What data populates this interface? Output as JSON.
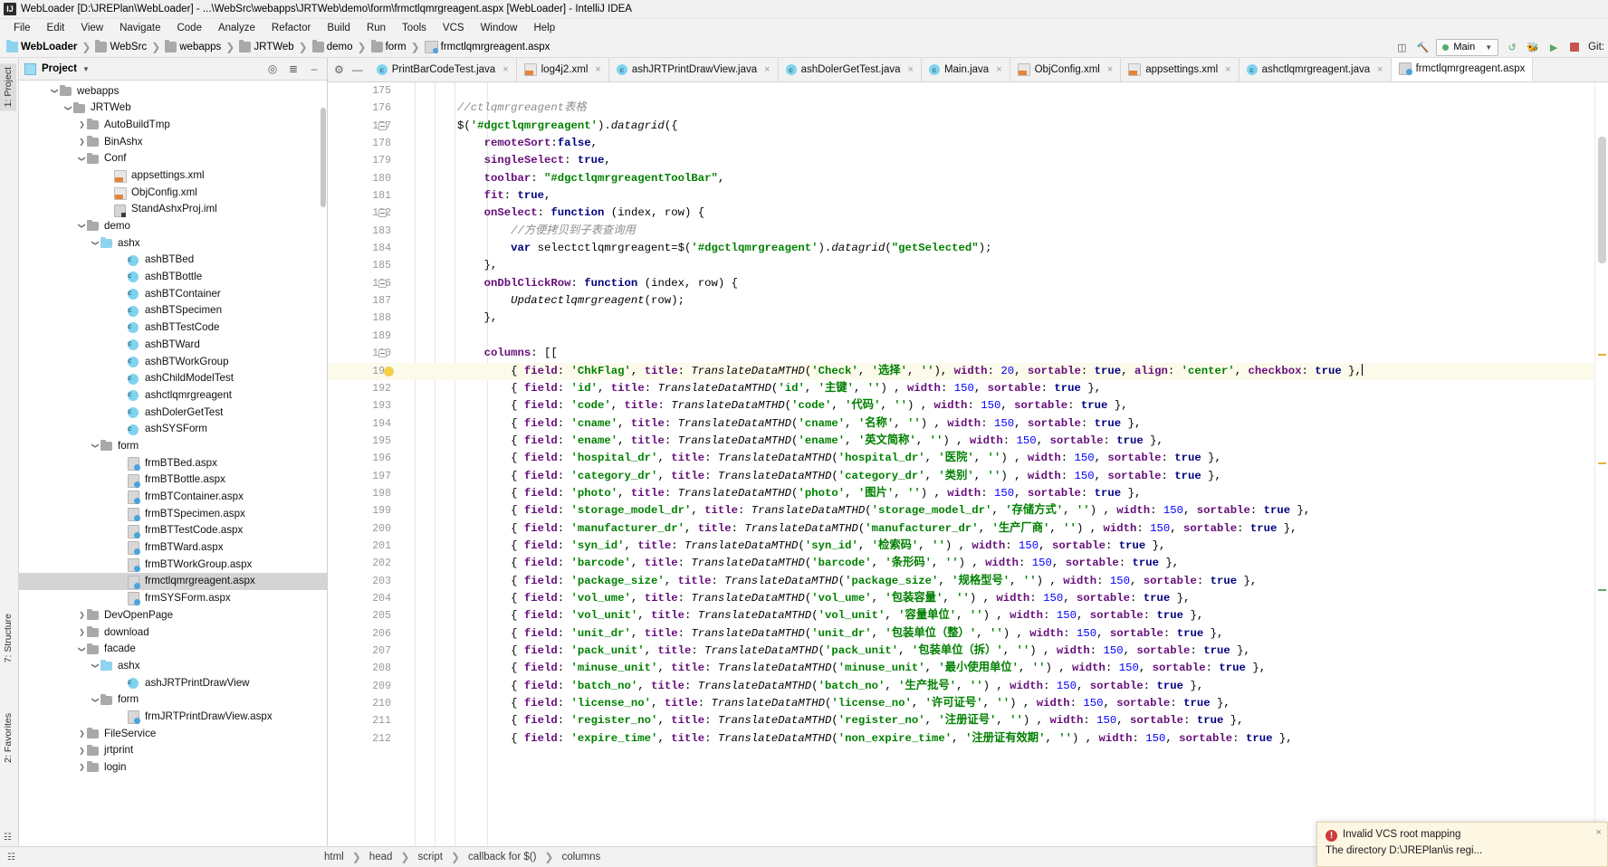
{
  "window": {
    "title": "WebLoader [D:\\JREPlan\\WebLoader] - ...\\WebSrc\\webapps\\JRTWeb\\demo\\form\\frmctlqmrgreagent.aspx [WebLoader] - IntelliJ IDEA",
    "app_icon": "IJ"
  },
  "menu": {
    "items": [
      "File",
      "Edit",
      "View",
      "Navigate",
      "Code",
      "Analyze",
      "Refactor",
      "Build",
      "Run",
      "Tools",
      "VCS",
      "Window",
      "Help"
    ]
  },
  "breadcrumb": {
    "items": [
      {
        "label": "WebLoader",
        "icon": "module-icon",
        "bold": true
      },
      {
        "label": "WebSrc",
        "icon": "folder-icon",
        "bold": false
      },
      {
        "label": "webapps",
        "icon": "folder-icon",
        "bold": false
      },
      {
        "label": "JRTWeb",
        "icon": "folder-icon",
        "bold": false
      },
      {
        "label": "demo",
        "icon": "folder-icon",
        "bold": false
      },
      {
        "label": "form",
        "icon": "folder-icon",
        "bold": false
      },
      {
        "label": "frmctlqmrgreagent.aspx",
        "icon": "aspx-file-icon",
        "bold": false
      }
    ]
  },
  "toolbar_right": {
    "run_config": "Main",
    "git_label": "Git:",
    "icons": [
      "layout-icon",
      "hammer-icon",
      "rerun-icon",
      "debug-icon",
      "coverage-icon",
      "stop-icon"
    ]
  },
  "project_panel": {
    "title": "Project",
    "header_icons": [
      "locate-icon",
      "collapse-all-icon",
      "hide-icon"
    ],
    "tree": [
      {
        "indent": 2,
        "arrow": "down",
        "icon": "folder-icon",
        "label": "webapps",
        "selected": false
      },
      {
        "indent": 3,
        "arrow": "down",
        "icon": "folder-icon",
        "label": "JRTWeb",
        "selected": false
      },
      {
        "indent": 4,
        "arrow": "right",
        "icon": "folder-icon",
        "label": "AutoBuildTmp",
        "selected": false
      },
      {
        "indent": 4,
        "arrow": "right",
        "icon": "folder-icon",
        "label": "BinAshx",
        "selected": false
      },
      {
        "indent": 4,
        "arrow": "down",
        "icon": "folder-icon",
        "label": "Conf",
        "selected": false
      },
      {
        "indent": 6,
        "arrow": "none",
        "icon": "xml-file-icon",
        "label": "appsettings.xml",
        "selected": false
      },
      {
        "indent": 6,
        "arrow": "none",
        "icon": "xml-file-icon",
        "label": "ObjConfig.xml",
        "selected": false
      },
      {
        "indent": 6,
        "arrow": "none",
        "icon": "iml-file-icon",
        "label": "StandAshxProj.iml",
        "selected": false
      },
      {
        "indent": 4,
        "arrow": "down",
        "icon": "folder-icon",
        "label": "demo",
        "selected": false
      },
      {
        "indent": 5,
        "arrow": "down",
        "icon": "folder-blue-icon",
        "label": "ashx",
        "selected": false
      },
      {
        "indent": 7,
        "arrow": "none",
        "icon": "class-icon",
        "label": "ashBTBed",
        "selected": false
      },
      {
        "indent": 7,
        "arrow": "none",
        "icon": "class-icon",
        "label": "ashBTBottle",
        "selected": false
      },
      {
        "indent": 7,
        "arrow": "none",
        "icon": "class-icon",
        "label": "ashBTContainer",
        "selected": false
      },
      {
        "indent": 7,
        "arrow": "none",
        "icon": "class-icon",
        "label": "ashBTSpecimen",
        "selected": false
      },
      {
        "indent": 7,
        "arrow": "none",
        "icon": "class-icon",
        "label": "ashBTTestCode",
        "selected": false
      },
      {
        "indent": 7,
        "arrow": "none",
        "icon": "class-icon",
        "label": "ashBTWard",
        "selected": false
      },
      {
        "indent": 7,
        "arrow": "none",
        "icon": "class-icon",
        "label": "ashBTWorkGroup",
        "selected": false
      },
      {
        "indent": 7,
        "arrow": "none",
        "icon": "class-icon",
        "label": "ashChildModelTest",
        "selected": false
      },
      {
        "indent": 7,
        "arrow": "none",
        "icon": "class-icon",
        "label": "ashctlqmrgreagent",
        "selected": false
      },
      {
        "indent": 7,
        "arrow": "none",
        "icon": "class-icon",
        "label": "ashDolerGetTest",
        "selected": false
      },
      {
        "indent": 7,
        "arrow": "none",
        "icon": "class-icon",
        "label": "ashSYSForm",
        "selected": false
      },
      {
        "indent": 5,
        "arrow": "down",
        "icon": "folder-icon",
        "label": "form",
        "selected": false
      },
      {
        "indent": 7,
        "arrow": "none",
        "icon": "aspx-file-icon",
        "label": "frmBTBed.aspx",
        "selected": false
      },
      {
        "indent": 7,
        "arrow": "none",
        "icon": "aspx-file-icon",
        "label": "frmBTBottle.aspx",
        "selected": false
      },
      {
        "indent": 7,
        "arrow": "none",
        "icon": "aspx-file-icon",
        "label": "frmBTContainer.aspx",
        "selected": false
      },
      {
        "indent": 7,
        "arrow": "none",
        "icon": "aspx-file-icon",
        "label": "frmBTSpecimen.aspx",
        "selected": false
      },
      {
        "indent": 7,
        "arrow": "none",
        "icon": "aspx-file-icon",
        "label": "frmBTTestCode.aspx",
        "selected": false
      },
      {
        "indent": 7,
        "arrow": "none",
        "icon": "aspx-file-icon",
        "label": "frmBTWard.aspx",
        "selected": false
      },
      {
        "indent": 7,
        "arrow": "none",
        "icon": "aspx-file-icon",
        "label": "frmBTWorkGroup.aspx",
        "selected": false
      },
      {
        "indent": 7,
        "arrow": "none",
        "icon": "aspx-file-icon",
        "label": "frmctlqmrgreagent.aspx",
        "selected": true
      },
      {
        "indent": 7,
        "arrow": "none",
        "icon": "aspx-file-icon",
        "label": "frmSYSForm.aspx",
        "selected": false
      },
      {
        "indent": 4,
        "arrow": "right",
        "icon": "folder-icon",
        "label": "DevOpenPage",
        "selected": false
      },
      {
        "indent": 4,
        "arrow": "right",
        "icon": "folder-icon",
        "label": "download",
        "selected": false
      },
      {
        "indent": 4,
        "arrow": "down",
        "icon": "folder-icon",
        "label": "facade",
        "selected": false
      },
      {
        "indent": 5,
        "arrow": "down",
        "icon": "folder-blue-icon",
        "label": "ashx",
        "selected": false
      },
      {
        "indent": 7,
        "arrow": "none",
        "icon": "class-icon",
        "label": "ashJRTPrintDrawView",
        "selected": false
      },
      {
        "indent": 5,
        "arrow": "down",
        "icon": "folder-icon",
        "label": "form",
        "selected": false
      },
      {
        "indent": 7,
        "arrow": "none",
        "icon": "aspx-file-icon",
        "label": "frmJRTPrintDrawView.aspx",
        "selected": false
      },
      {
        "indent": 4,
        "arrow": "right",
        "icon": "folder-icon",
        "label": "FileService",
        "selected": false
      },
      {
        "indent": 4,
        "arrow": "right",
        "icon": "folder-icon",
        "label": "jrtprint",
        "selected": false
      },
      {
        "indent": 4,
        "arrow": "right",
        "icon": "folder-icon",
        "label": "login",
        "selected": false
      }
    ]
  },
  "left_rail": {
    "tabs": [
      "1: Project",
      "7: Structure",
      "2: Favorites"
    ]
  },
  "editor_tabs": [
    {
      "label": "PrintBarCodeTest.java",
      "icon": "java-class-icon",
      "active": false
    },
    {
      "label": "log4j2.xml",
      "icon": "xml-file-icon",
      "active": false
    },
    {
      "label": "ashJRTPrintDrawView.java",
      "icon": "java-class-icon",
      "active": false
    },
    {
      "label": "ashDolerGetTest.java",
      "icon": "java-class-icon",
      "active": false
    },
    {
      "label": "Main.java",
      "icon": "java-class-icon",
      "active": false
    },
    {
      "label": "ObjConfig.xml",
      "icon": "xml-file-icon",
      "active": false
    },
    {
      "label": "appsettings.xml",
      "icon": "xml-file-icon",
      "active": false
    },
    {
      "label": "ashctlqmrgreagent.java",
      "icon": "java-class-icon",
      "active": false
    },
    {
      "label": "frmctlqmrgreagent.aspx",
      "icon": "aspx-file-icon",
      "active": true
    }
  ],
  "code": {
    "first_line": 175,
    "highlight_line": 191,
    "lines": [
      {
        "n": 175,
        "text": ""
      },
      {
        "n": 176,
        "text": "        //ctlqmrgreagent表格"
      },
      {
        "n": 177,
        "text": "        $('#dgctlqmrgreagent').datagrid({"
      },
      {
        "n": 178,
        "text": "            remoteSort:false,"
      },
      {
        "n": 179,
        "text": "            singleSelect: true,"
      },
      {
        "n": 180,
        "text": "            toolbar: \"#dgctlqmrgreagentToolBar\","
      },
      {
        "n": 181,
        "text": "            fit: true,"
      },
      {
        "n": 182,
        "text": "            onSelect: function (index, row) {"
      },
      {
        "n": 183,
        "text": "                //方便拷贝到子表查询用"
      },
      {
        "n": 184,
        "text": "                var selectctlqmrgreagent=$('#dgctlqmrgreagent').datagrid(\"getSelected\");"
      },
      {
        "n": 185,
        "text": "            },"
      },
      {
        "n": 186,
        "text": "            onDblClickRow: function (index, row) {"
      },
      {
        "n": 187,
        "text": "                Updatectlqmrgreagent(row);"
      },
      {
        "n": 188,
        "text": "            },"
      },
      {
        "n": 189,
        "text": ""
      },
      {
        "n": 190,
        "text": "            columns: [["
      },
      {
        "n": 191,
        "text": "                { field: 'ChkFlag', title: TranslateDataMTHD('Check', '选择', ''), width: 20, sortable: true, align: 'center', checkbox: true },"
      },
      {
        "n": 192,
        "text": "                { field: 'id', title: TranslateDataMTHD('id', '主键', '') , width: 150, sortable: true },"
      },
      {
        "n": 193,
        "text": "                { field: 'code', title: TranslateDataMTHD('code', '代码', '') , width: 150, sortable: true },"
      },
      {
        "n": 194,
        "text": "                { field: 'cname', title: TranslateDataMTHD('cname', '名称', '') , width: 150, sortable: true },"
      },
      {
        "n": 195,
        "text": "                { field: 'ename', title: TranslateDataMTHD('ename', '英文简称', '') , width: 150, sortable: true },"
      },
      {
        "n": 196,
        "text": "                { field: 'hospital_dr', title: TranslateDataMTHD('hospital_dr', '医院', '') , width: 150, sortable: true },"
      },
      {
        "n": 197,
        "text": "                { field: 'category_dr', title: TranslateDataMTHD('category_dr', '类别', '') , width: 150, sortable: true },"
      },
      {
        "n": 198,
        "text": "                { field: 'photo', title: TranslateDataMTHD('photo', '图片', '') , width: 150, sortable: true },"
      },
      {
        "n": 199,
        "text": "                { field: 'storage_model_dr', title: TranslateDataMTHD('storage_model_dr', '存储方式', '') , width: 150, sortable: true },"
      },
      {
        "n": 200,
        "text": "                { field: 'manufacturer_dr', title: TranslateDataMTHD('manufacturer_dr', '生产厂商', '') , width: 150, sortable: true },"
      },
      {
        "n": 201,
        "text": "                { field: 'syn_id', title: TranslateDataMTHD('syn_id', '检索码', '') , width: 150, sortable: true },"
      },
      {
        "n": 202,
        "text": "                { field: 'barcode', title: TranslateDataMTHD('barcode', '条形码', '') , width: 150, sortable: true },"
      },
      {
        "n": 203,
        "text": "                { field: 'package_size', title: TranslateDataMTHD('package_size', '规格型号', '') , width: 150, sortable: true },"
      },
      {
        "n": 204,
        "text": "                { field: 'vol_ume', title: TranslateDataMTHD('vol_ume', '包装容量', '') , width: 150, sortable: true },"
      },
      {
        "n": 205,
        "text": "                { field: 'vol_unit', title: TranslateDataMTHD('vol_unit', '容量单位', '') , width: 150, sortable: true },"
      },
      {
        "n": 206,
        "text": "                { field: 'unit_dr', title: TranslateDataMTHD('unit_dr', '包装单位（整）', '') , width: 150, sortable: true },"
      },
      {
        "n": 207,
        "text": "                { field: 'pack_unit', title: TranslateDataMTHD('pack_unit', '包装单位（拆）', '') , width: 150, sortable: true },"
      },
      {
        "n": 208,
        "text": "                { field: 'minuse_unit', title: TranslateDataMTHD('minuse_unit', '最小使用单位', '') , width: 150, sortable: true },"
      },
      {
        "n": 209,
        "text": "                { field: 'batch_no', title: TranslateDataMTHD('batch_no', '生产批号', '') , width: 150, sortable: true },"
      },
      {
        "n": 210,
        "text": "                { field: 'license_no', title: TranslateDataMTHD('license_no', '许可证号', '') , width: 150, sortable: true },"
      },
      {
        "n": 211,
        "text": "                { field: 'register_no', title: TranslateDataMTHD('register_no', '注册证号', '') , width: 150, sortable: true },"
      },
      {
        "n": 212,
        "text": "                { field: 'expire_time', title: TranslateDataMTHD('non_expire_time', '注册证有效期', '') , width: 150, sortable: true },"
      }
    ]
  },
  "status_breadcrumb": [
    "html",
    "head",
    "script",
    "callback for $()",
    "columns"
  ],
  "notification": {
    "title": "Invalid VCS root mapping",
    "text": "The directory D:\\JREPlan\\is regi...",
    "close": "×"
  }
}
